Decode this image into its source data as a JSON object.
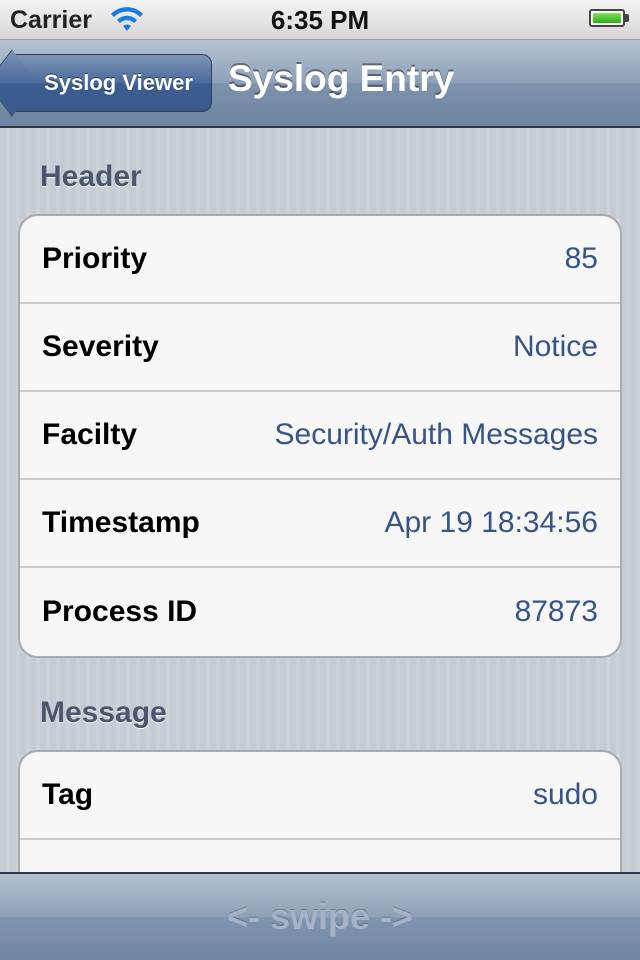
{
  "status_bar": {
    "carrier": "Carrier",
    "time": "6:35 PM",
    "wifi_icon": "wifi-icon",
    "battery_icon": "battery-icon",
    "battery_level": 1.0
  },
  "nav": {
    "back_label": "Syslog Viewer",
    "title": "Syslog Entry"
  },
  "sections": [
    {
      "header": "Header",
      "rows": [
        {
          "label": "Priority",
          "value": "85"
        },
        {
          "label": "Severity",
          "value": "Notice"
        },
        {
          "label": "Facilty",
          "value": "Security/Auth Messages"
        },
        {
          "label": "Timestamp",
          "value": "Apr 19 18:34:56"
        },
        {
          "label": "Process ID",
          "value": "87873"
        }
      ]
    },
    {
      "header": "Message",
      "rows": [
        {
          "label": "Tag",
          "value": "sudo"
        },
        {
          "label": "",
          "value": ""
        }
      ]
    }
  ],
  "toolbar": {
    "hint": "<- swipe ->"
  },
  "colors": {
    "value_text": "#385487",
    "section_header": "#4c566c",
    "nav_bar": "#7d92ac",
    "battery_fill": "#2fae16"
  }
}
